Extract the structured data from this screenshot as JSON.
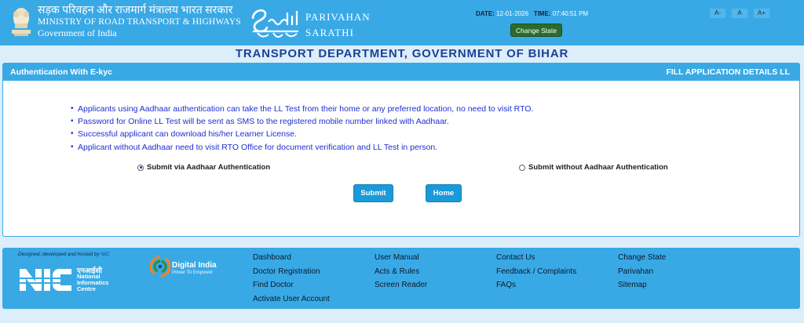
{
  "header": {
    "ministry_hindi": "सड़क परिवहन और राजमार्ग मंत्रालय भारत सरकार",
    "ministry_english": "MINISTRY OF ROAD TRANSPORT & HIGHWAYS",
    "government": "Government of India",
    "sarathi_line1": "PARIVAHAN",
    "sarathi_line2": "SARATHI",
    "date_label": "DATE:",
    "date_value": "12-01-2026",
    "time_label": "TIME:",
    "time_value": "07:40:51 PM",
    "change_state_label": "Change State",
    "font_controls": [
      "A-",
      "A",
      "A+"
    ]
  },
  "title": "TRANSPORT DEPARTMENT, GOVERNMENT OF BIHAR",
  "panel": {
    "left_title": "Authentication With E-kyc",
    "right_title": "FILL APPLICATION DETAILS LL",
    "info": [
      "Applicants using Aadhaar authentication can take the LL Test from their home or any preferred location, no need to visit RTO.",
      "Password for Online LL Test will be sent as SMS to the registered mobile number linked with Aadhaar.",
      "Successful applicant can download his/her Learner License.",
      "Applicant without Aadhaar need to visit RTO Office for document verification and LL Test in person."
    ],
    "option_with_aadhaar": "Submit via Aadhaar Authentication",
    "option_without_aadhaar": "Submit without Aadhaar Authentication",
    "submit_label": "Submit",
    "home_label": "Home"
  },
  "footer": {
    "hosted_text": "Designed, developed and hosted by",
    "hosted_by": "NIC",
    "nic_hindi": "एनआईसी",
    "nic_line1": "National",
    "nic_line2": "Informatics",
    "nic_line3": "Centre",
    "digital_india": "Digital India",
    "digital_india_tag": "Power To Empower",
    "col1": [
      "Dashboard",
      "Doctor Registration",
      "Find Doctor",
      "Activate User Account"
    ],
    "col2": [
      "User Manual",
      "Acts & Rules",
      "Screen Reader"
    ],
    "col3": [
      "Contact Us",
      "Feedback / Complaints",
      "FAQs"
    ],
    "col4": [
      "Change State",
      "Parivahan",
      "Sitemap"
    ]
  },
  "colors": {
    "header_blue": "#39a9e6",
    "title_blue": "#1f3f95",
    "info_text": "#1e2ed2",
    "button_blue": "#1a9ad8",
    "change_state_green": "#2b6c2d"
  }
}
